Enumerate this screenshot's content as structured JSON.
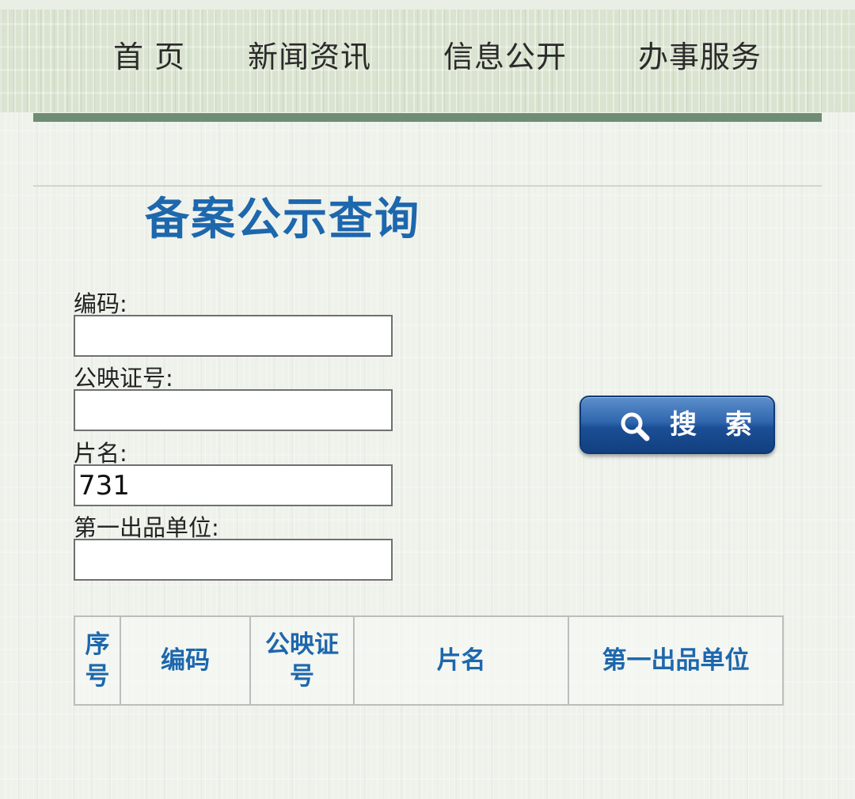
{
  "nav": {
    "items": [
      {
        "label": "首 页"
      },
      {
        "label": "新闻资讯"
      },
      {
        "label": "信息公开"
      },
      {
        "label": "办事服务"
      }
    ]
  },
  "page": {
    "title": "备案公示查询"
  },
  "form": {
    "code": {
      "label": "编码:",
      "value": ""
    },
    "license": {
      "label": "公映证号:",
      "value": ""
    },
    "film_name": {
      "label": "片名:",
      "value": "731"
    },
    "producer": {
      "label": "第一出品单位:",
      "value": ""
    },
    "search_label": "搜 索"
  },
  "table": {
    "headers": [
      "序号",
      "编码",
      "公映证号",
      "片名",
      "第一出品单位"
    ]
  },
  "colors": {
    "title_blue": "#1d67ad",
    "nav_bar_green": "#6e8d74",
    "button_blue": "#1b4f96"
  },
  "icons": {
    "search_button": "search-icon"
  }
}
